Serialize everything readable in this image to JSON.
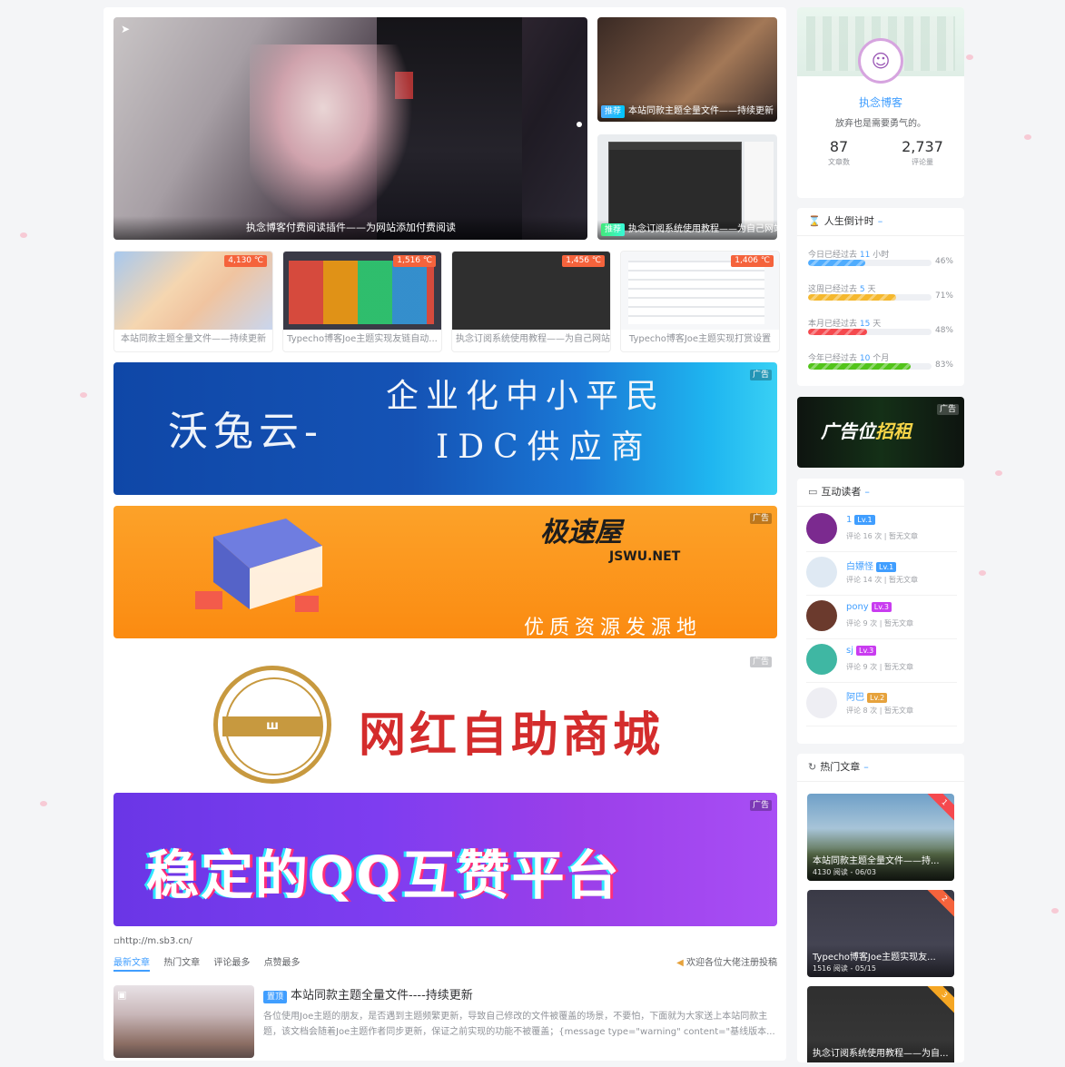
{
  "hero": {
    "main_caption": "执念博客付费阅读插件——为网站添加付费阅读",
    "side": [
      {
        "tag": "推荐",
        "title": "本站同款主题全量文件——持续更新"
      },
      {
        "tag": "推荐",
        "title": "执念订阅系统使用教程——为自己网站"
      }
    ]
  },
  "thumbs": [
    {
      "temp": "4,130 ℃",
      "title": "本站同款主题全量文件——持续更新"
    },
    {
      "temp": "1,516 ℃",
      "title": "Typecho博客Joe主题实现友链自动..."
    },
    {
      "temp": "1,456 ℃",
      "title": "执念订阅系统使用教程——为自己网站..."
    },
    {
      "temp": "1,406 ℃",
      "title": "Typecho博客Joe主题实现打赏设置"
    }
  ],
  "ads": {
    "badge": "广告",
    "ad1": {
      "line1": "企业化中小平民",
      "line2": "沃兔云-",
      "line3": "IDC供应商"
    },
    "ad2": {
      "logo": "极速屋",
      "logo_en": "JSWU.NET",
      "slogan": "优质资源发源地"
    },
    "ad3": {
      "text": "网红自助商城",
      "emblem": "ш"
    },
    "ad4": {
      "text": "稳定的QQ互赞平台"
    }
  },
  "broken_image_alt": "http://m.sb3.cn/",
  "tabs": {
    "items": [
      "最新文章",
      "热门文章",
      "评论最多",
      "点赞最多"
    ],
    "notice": "欢迎各位大佬注册投稿"
  },
  "article": {
    "badge": "置顶",
    "title": "本站同款主题全量文件----持续更新",
    "excerpt": "各位使用Joe主题的朋友，是否遇到主题频繁更新，导致自己修改的文件被覆盖的场景，不要怕，下面就为大家送上本站同款主题，该文档会随着Joe主题作者同步更新，保证之前实现的功能不被覆盖；{message type=\"warning\" content=\"基线版本..."
  },
  "profile": {
    "name": "执念博客",
    "motto": "放弃也是需要勇气的。",
    "stats": [
      {
        "num": "87",
        "label": "文章数"
      },
      {
        "num": "2,737",
        "label": "评论量"
      }
    ]
  },
  "countdown": {
    "title": "人生倒计时",
    "rows": [
      {
        "prefix": "今日已经过去",
        "value": "11",
        "unit": "小时",
        "percent": 46,
        "pct_label": "46%",
        "color": "#4facfe"
      },
      {
        "prefix": "这周已经过去",
        "value": "5",
        "unit": "天",
        "percent": 71,
        "pct_label": "71%",
        "color": "#f5b82e"
      },
      {
        "prefix": "本月已经过去",
        "value": "15",
        "unit": "天",
        "percent": 48,
        "pct_label": "48%",
        "color": "#f5494e"
      },
      {
        "prefix": "今年已经过去",
        "value": "10",
        "unit": "个月",
        "percent": 83,
        "pct_label": "83%",
        "color": "#52c41a"
      }
    ]
  },
  "side_ad": {
    "badge": "广告",
    "text_a": "广告位",
    "text_b": "招租"
  },
  "readers": {
    "title": "互动读者",
    "items": [
      {
        "name": "1",
        "level": "Lv.1",
        "meta": "评论 16 次 | 暂无文章",
        "level_color": "#409eff"
      },
      {
        "name": "白嫖怪",
        "level": "Lv.1",
        "meta": "评论 14 次 | 暂无文章",
        "level_color": "#409eff"
      },
      {
        "name": "pony",
        "level": "Lv.3",
        "meta": "评论 9 次 | 暂无文章",
        "level_color": "#c93cf0"
      },
      {
        "name": "sj",
        "level": "Lv.3",
        "meta": "评论 9 次 | 暂无文章",
        "level_color": "#c93cf0"
      },
      {
        "name": "阿巴",
        "level": "Lv.2",
        "meta": "评论 8 次 | 暂无文章",
        "level_color": "#e6a23c"
      }
    ]
  },
  "hot": {
    "title": "热门文章",
    "items": [
      {
        "rank": "1",
        "title": "本站同款主题全量文件——持...",
        "meta": "4130 阅读 - 06/03"
      },
      {
        "rank": "2",
        "title": "Typecho博客Joe主题实现友...",
        "meta": "1516 阅读 - 05/15"
      },
      {
        "rank": "3",
        "title": "执念订阅系统使用教程——为自...",
        "meta": ""
      }
    ]
  }
}
